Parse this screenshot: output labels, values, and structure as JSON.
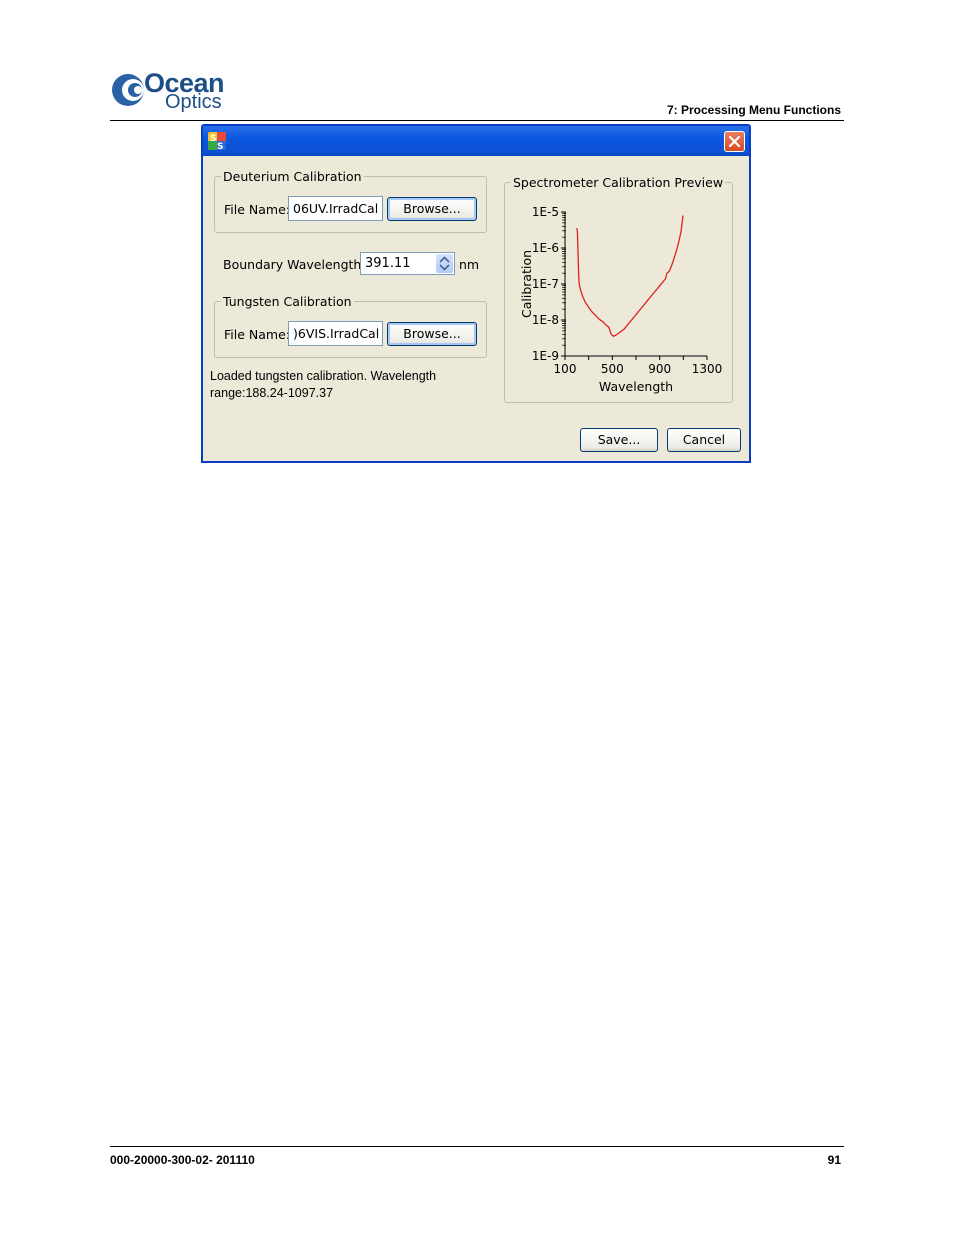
{
  "page": {
    "brand_line1": "Ocean",
    "brand_line2": "Optics",
    "header_title": "7: Processing Menu Functions",
    "footer_doc": "000-20000-300-02- 201110",
    "footer_page": "91",
    "brand_color": "#1d4e86"
  },
  "dialog": {
    "deuterium": {
      "legend": "Deuterium Calibration",
      "file_label": "File Name:",
      "file_value": "06UV.IrradCal",
      "browse_label": "Browse..."
    },
    "boundary": {
      "label": "Boundary Wavelength:",
      "value": "391.11",
      "unit": "nm"
    },
    "tungsten": {
      "legend": "Tungsten Calibration",
      "file_label": "File Name:",
      "file_value": ")6VIS.IrradCal",
      "browse_label": "Browse..."
    },
    "status_text": "Loaded tungsten calibration. Wavelength range:188.24-1097.37",
    "preview": {
      "legend": "Spectrometer Calibration Preview"
    },
    "save_label": "Save...",
    "cancel_label": "Cancel",
    "icons": [
      "app-icon",
      "close-icon",
      "spin-up-icon",
      "spin-down-icon"
    ]
  },
  "chart_data": {
    "type": "line",
    "title": "",
    "xlabel": "Wavelength",
    "ylabel": "Calibration",
    "xlim": [
      100,
      1300
    ],
    "ylim": [
      "1E-9",
      "1E-5"
    ],
    "x_ticks": [
      "100",
      "500",
      "900",
      "1300"
    ],
    "y_ticks": [
      "1E-5",
      "1E-6",
      "1E-7",
      "1E-8",
      "1E-9"
    ],
    "log_y": true,
    "line_color": "#e02020",
    "series": [
      {
        "x": [
          200,
          205,
          210,
          215,
          220,
          230,
          250,
          270,
          300,
          330,
          360,
          390,
          420,
          450,
          470,
          490,
          510,
          530,
          560,
          600,
          650,
          700,
          750,
          800,
          850,
          900,
          950,
          960,
          980,
          1000,
          1020,
          1040,
          1060,
          1080,
          1097
        ],
        "y_log10": [
          -5.45,
          -5.55,
          -6.1,
          -6.7,
          -7.0,
          -7.15,
          -7.35,
          -7.5,
          -7.65,
          -7.78,
          -7.88,
          -7.98,
          -8.05,
          -8.15,
          -8.2,
          -8.4,
          -8.45,
          -8.42,
          -8.35,
          -8.25,
          -8.05,
          -7.85,
          -7.65,
          -7.45,
          -7.25,
          -7.05,
          -6.85,
          -6.7,
          -6.65,
          -6.5,
          -6.3,
          -6.1,
          -5.85,
          -5.55,
          -5.1
        ]
      }
    ]
  }
}
